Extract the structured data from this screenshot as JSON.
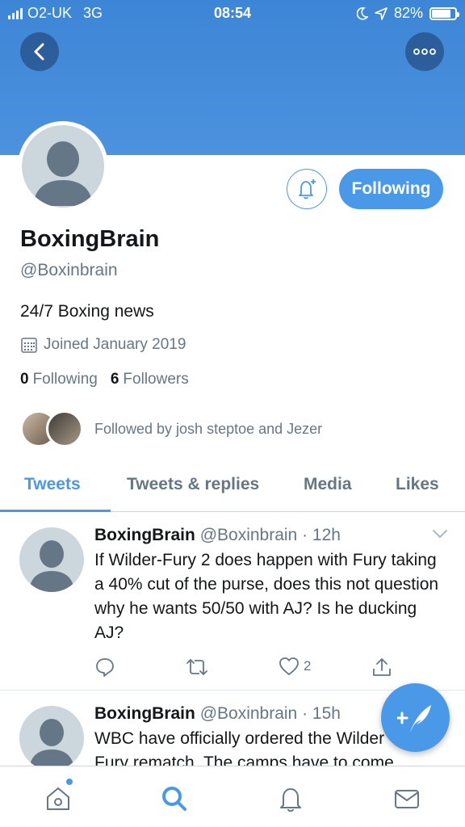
{
  "status_bar": {
    "carrier": "O2-UK",
    "network": "3G",
    "time": "08:54",
    "battery": "82%",
    "battery_level": 0.82
  },
  "profile": {
    "name": "BoxingBrain",
    "handle": "@Boxinbrain",
    "bio": "24/7 Boxing news",
    "joined": "Joined January 2019",
    "following_count": "0",
    "following_label": "Following",
    "followers_count": "6",
    "followers_label": "Followers",
    "followed_by": "Followed by josh steptoe and Jezer",
    "follow_button": "Following"
  },
  "tabs": [
    {
      "label": "Tweets",
      "active": true
    },
    {
      "label": "Tweets & replies",
      "active": false
    },
    {
      "label": "Media",
      "active": false
    },
    {
      "label": "Likes",
      "active": false
    }
  ],
  "tweets": [
    {
      "name": "BoxingBrain",
      "handle": "@Boxinbrain",
      "time": "· 12h",
      "text": "If Wilder-Fury 2 does happen with Fury taking a 40% cut of the purse, does this not question why he wants 50/50 with AJ? Is he ducking AJ?",
      "likes": "2"
    },
    {
      "name": "BoxingBrain",
      "handle": "@Boxinbrain",
      "time": "· 15h",
      "text": "WBC have officially ordered the Wilder Fury rematch. The camps have to come"
    }
  ],
  "colors": {
    "accent": "#4a99e9",
    "banner": "#3d85d6",
    "secondary_text": "#657786",
    "avatar_placeholder": "#ccd6dd"
  },
  "icons": {
    "back": "chevron-left-icon",
    "more": "more-icon",
    "bell": "bell-plus-icon",
    "calendar": "calendar-icon",
    "reply": "reply-icon",
    "retweet": "retweet-icon",
    "like": "heart-icon",
    "share": "share-icon",
    "compose": "compose-icon",
    "home": "home-icon",
    "search": "search-icon",
    "notifications": "notifications-icon",
    "messages": "messages-icon"
  }
}
